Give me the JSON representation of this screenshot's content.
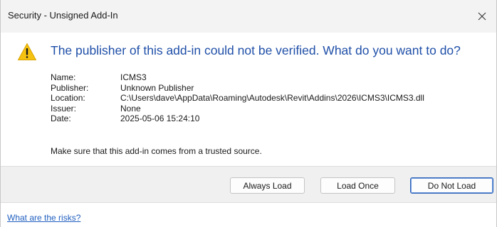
{
  "window": {
    "title": "Security - Unsigned Add-In",
    "close_icon": "close-icon"
  },
  "message": {
    "icon": "warning-icon",
    "icon_color": "#f5c211",
    "headline": "The publisher of this add-in could not be verified. What do you want to do?",
    "headline_color": "#1f4fa8"
  },
  "details": [
    {
      "label": "Name:",
      "value": "ICMS3"
    },
    {
      "label": "Publisher:",
      "value": "Unknown Publisher"
    },
    {
      "label": "Location:",
      "value": "C:\\Users\\dave\\AppData\\Roaming\\Autodesk\\Revit\\Addins\\2026\\ICMS3\\ICMS3.dll"
    },
    {
      "label": "Issuer:",
      "value": "None"
    },
    {
      "label": "Date:",
      "value": "2025-05-06 15:24:10"
    }
  ],
  "trust_note": "Make sure that this add-in comes from a trusted source.",
  "buttons": {
    "always_load": "Always Load",
    "load_once": "Load Once",
    "do_not_load": "Do Not Load",
    "focused": "do_not_load",
    "focus_color": "#2b62b8"
  },
  "footer": {
    "risk_link": "What are the risks?",
    "link_color": "#1f5fbf"
  }
}
